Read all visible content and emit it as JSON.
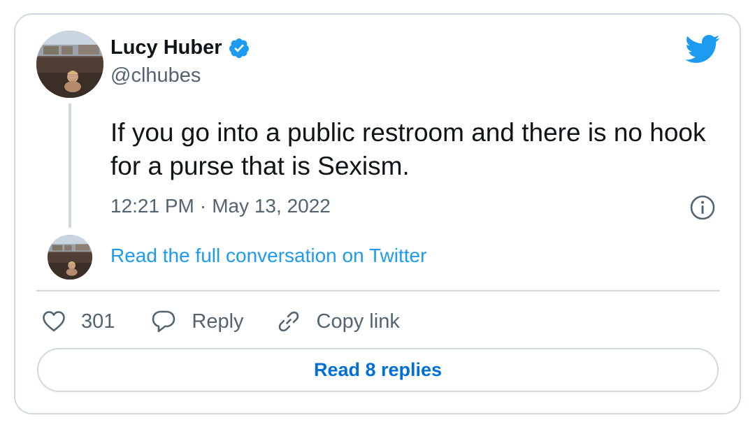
{
  "tweet": {
    "display_name": "Lucy Huber",
    "handle": "@clhubes",
    "text": "If you go into a public restroom and there is no hook for a purse that is Sexism.",
    "time": "12:21 PM",
    "separator": "·",
    "date": "May 13, 2022"
  },
  "conversation_link": "Read the full conversation on Twitter",
  "actions": {
    "like_count": "301",
    "reply_label": "Reply",
    "copy_label": "Copy link"
  },
  "read_replies_label": "Read 8 replies",
  "colors": {
    "accent": "#1d9bf0",
    "link_button": "#006fd6",
    "border": "#cfd9de",
    "muted_text": "#536471"
  },
  "icons": [
    "verified-badge-icon",
    "twitter-bird-icon",
    "info-icon",
    "heart-icon",
    "reply-bubble-icon",
    "link-icon"
  ]
}
